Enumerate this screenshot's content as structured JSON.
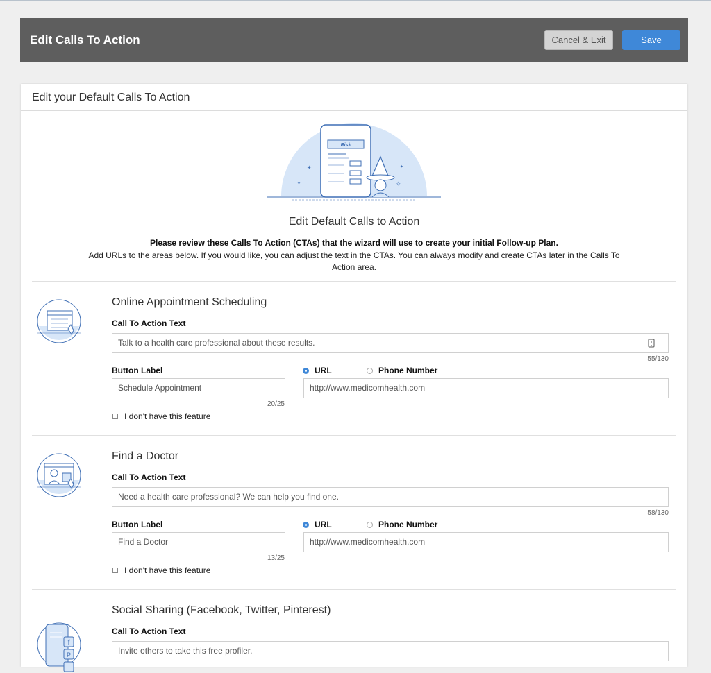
{
  "header": {
    "title": "Edit Calls To Action",
    "cancel_label": "Cancel & Exit",
    "save_label": "Save"
  },
  "card": {
    "title": "Edit your Default Calls To Action",
    "hero_badge": "Risk",
    "intro_title": "Edit Default Calls to Action",
    "intro_bold": "Please review these Calls To Action (CTAs) that the wizard will use to create your initial Follow-up Plan.",
    "intro_text": "Add URLs to the areas below. If you would like, you can adjust the text in the CTAs. You can always modify and create CTAs later in the Calls To Action area."
  },
  "labels": {
    "cta_text": "Call To Action Text",
    "button_label": "Button Label",
    "url": "URL",
    "phone": "Phone Number",
    "no_feature": "I don't have this feature"
  },
  "sections": [
    {
      "title": "Online Appointment Scheduling",
      "cta_text": "Talk to a health care professional about these results.",
      "cta_count": "55/130",
      "button_label": "Schedule Appointment",
      "button_count": "20/25",
      "url": "http://www.medicomhealth.com",
      "icon": "calendar-click-icon"
    },
    {
      "title": "Find a Doctor",
      "cta_text": "Need a health care professional? We can help you find one.",
      "cta_count": "58/130",
      "button_label": "Find a Doctor",
      "button_count": "13/25",
      "url": "http://www.medicomhealth.com",
      "icon": "doctor-screen-icon"
    },
    {
      "title": "Social Sharing (Facebook, Twitter, Pinterest)",
      "cta_text": "Invite others to take this free profiler.",
      "icon": "social-phone-icon"
    }
  ],
  "colors": {
    "header_bg": "#5e5e5e",
    "primary": "#3f88d8",
    "illustration": "#d7e6f8",
    "illustration_stroke": "#3f6fb5"
  }
}
